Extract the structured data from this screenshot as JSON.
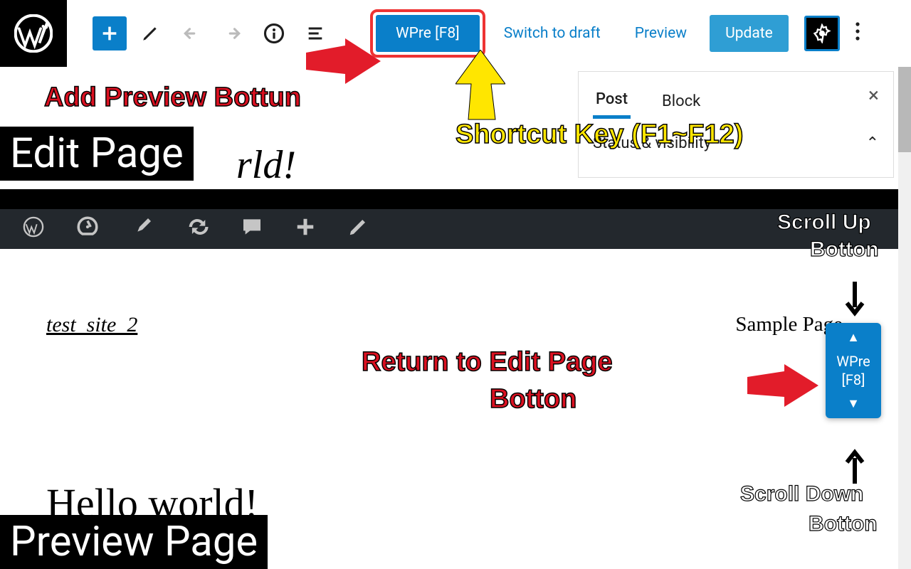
{
  "toolbar": {
    "wpre_label": "WPre [F8]",
    "switch_draft": "Switch to draft",
    "preview": "Preview",
    "update": "Update"
  },
  "sidebar": {
    "tabs": {
      "post": "Post",
      "block": "Block"
    },
    "close": "×",
    "status_row": "Status & visibility"
  },
  "annotations": {
    "add_preview": "Add Preview Bottun",
    "shortcut": "Shortcut Key (F1~F12)",
    "edit_page": "Edit Page",
    "preview_page": "Preview Page",
    "return_to_edit": "Return to Edit Page",
    "return_to_edit2": "Botton",
    "scroll_up": "Scroll Up",
    "scroll_up2": "Botton",
    "scroll_down": "Scroll Down",
    "scroll_down2": "Botton"
  },
  "content": {
    "world_fragment": "rld!",
    "site_title": "test_site_2",
    "sample_page": "Sample Page",
    "hello": "Hello world!"
  },
  "float": {
    "up": "▲",
    "label": "WPre\n[F8]",
    "label1": "WPre",
    "label2": "[F8]",
    "down": "▼"
  }
}
